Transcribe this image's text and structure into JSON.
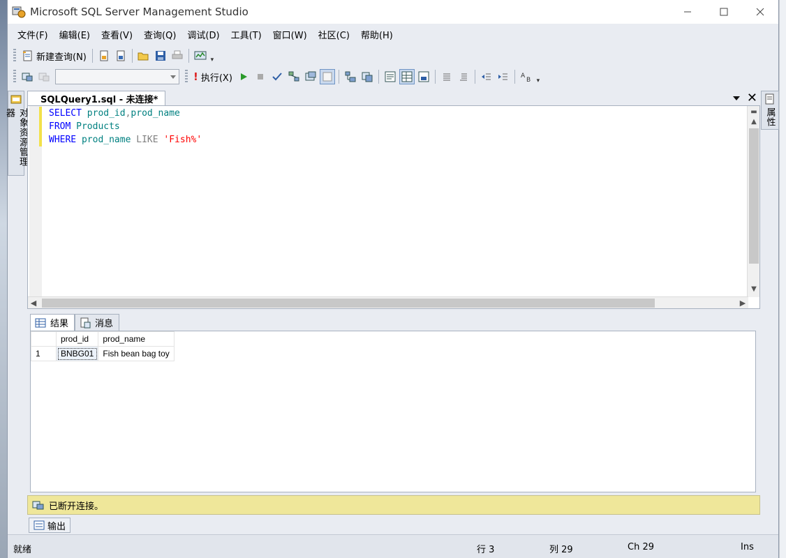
{
  "window": {
    "title": "Microsoft SQL Server Management Studio"
  },
  "menu": [
    "文件(F)",
    "编辑(E)",
    "查看(V)",
    "查询(Q)",
    "调试(D)",
    "工具(T)",
    "窗口(W)",
    "社区(C)",
    "帮助(H)"
  ],
  "toolbar": {
    "new_query_label": "新建查询(N)",
    "execute_label": "执行(X)",
    "database_combo_value": ""
  },
  "side_left": {
    "object_explorer_label": "对象资源管理器"
  },
  "side_right": {
    "properties_label": "属性"
  },
  "document": {
    "tab_title": "SQLQuery1.sql - 未连接*"
  },
  "editor": {
    "lines": [
      [
        {
          "t": "SELECT ",
          "c": "kw"
        },
        {
          "t": "prod_id",
          "c": "id"
        },
        {
          "t": ",",
          "c": "op"
        },
        {
          "t": "prod_name",
          "c": "id"
        }
      ],
      [
        {
          "t": "FROM ",
          "c": "kw"
        },
        {
          "t": "Products",
          "c": "id"
        }
      ],
      [
        {
          "t": "WHERE ",
          "c": "kw"
        },
        {
          "t": "prod_name ",
          "c": "id"
        },
        {
          "t": "LIKE ",
          "c": "op"
        },
        {
          "t": "'Fish%'",
          "c": "str"
        }
      ]
    ]
  },
  "results": {
    "tabs": [
      "结果",
      "消息"
    ],
    "columns": [
      "prod_id",
      "prod_name"
    ],
    "rows": [
      [
        "1",
        "BNBG01",
        "Fish bean bag toy"
      ]
    ]
  },
  "connection_status": "已断开连接。",
  "output_tab": "输出",
  "statusbar": {
    "ready": "就绪",
    "line": "行 3",
    "col": "列 29",
    "ch": "Ch 29",
    "mode": "Ins"
  },
  "colors": {
    "keyword": "#0000ff",
    "identifier": "#008080",
    "operator": "#808080",
    "string": "#ff0000",
    "connection_bar": "#efe79a"
  }
}
